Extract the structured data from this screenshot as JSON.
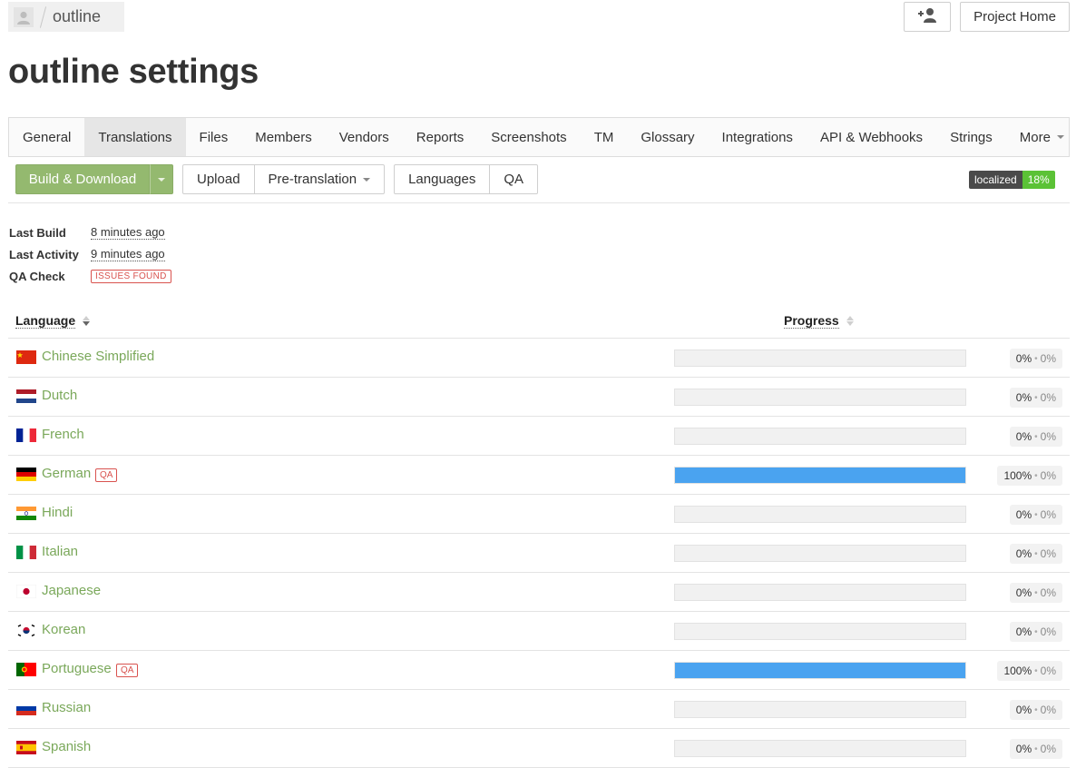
{
  "header": {
    "project_name": "outline",
    "project_home_label": "Project Home",
    "invite_icon": "user-plus-icon",
    "avatar_icon": "user-avatar-icon"
  },
  "page_title": "outline settings",
  "tabs": [
    {
      "label": "General",
      "active": false
    },
    {
      "label": "Translations",
      "active": true
    },
    {
      "label": "Files",
      "active": false
    },
    {
      "label": "Members",
      "active": false
    },
    {
      "label": "Vendors",
      "active": false
    },
    {
      "label": "Reports",
      "active": false
    },
    {
      "label": "Screenshots",
      "active": false
    },
    {
      "label": "TM",
      "active": false
    },
    {
      "label": "Glossary",
      "active": false
    },
    {
      "label": "Integrations",
      "active": false
    },
    {
      "label": "API & Webhooks",
      "active": false
    },
    {
      "label": "Strings",
      "active": false
    },
    {
      "label": "More",
      "active": false,
      "dropdown": true
    }
  ],
  "toolbar": {
    "build_label": "Build & Download",
    "upload_label": "Upload",
    "pretranslation_label": "Pre-translation",
    "languages_label": "Languages",
    "qa_label": "QA"
  },
  "status": {
    "label": "localized",
    "percent": "18%"
  },
  "info": {
    "last_build_label": "Last Build",
    "last_build_value": "8 minutes ago",
    "last_activity_label": "Last Activity",
    "last_activity_value": "9 minutes ago",
    "qa_check_label": "QA Check",
    "qa_check_value": "ISSUES FOUND"
  },
  "table": {
    "col_language": "Language",
    "col_progress": "Progress",
    "rows": [
      {
        "language": "Chinese Simplified",
        "flag": "cn",
        "qa": "",
        "progress": 0,
        "translated": "0%",
        "approved": "0%"
      },
      {
        "language": "Dutch",
        "flag": "nl",
        "qa": "",
        "progress": 0,
        "translated": "0%",
        "approved": "0%"
      },
      {
        "language": "French",
        "flag": "fr",
        "qa": "",
        "progress": 0,
        "translated": "0%",
        "approved": "0%"
      },
      {
        "language": "German",
        "flag": "de",
        "qa": "QA",
        "progress": 100,
        "translated": "100%",
        "approved": "0%"
      },
      {
        "language": "Hindi",
        "flag": "in",
        "qa": "",
        "progress": 0,
        "translated": "0%",
        "approved": "0%"
      },
      {
        "language": "Italian",
        "flag": "it",
        "qa": "",
        "progress": 0,
        "translated": "0%",
        "approved": "0%"
      },
      {
        "language": "Japanese",
        "flag": "jp",
        "qa": "",
        "progress": 0,
        "translated": "0%",
        "approved": "0%"
      },
      {
        "language": "Korean",
        "flag": "kr",
        "qa": "",
        "progress": 0,
        "translated": "0%",
        "approved": "0%"
      },
      {
        "language": "Portuguese",
        "flag": "pt",
        "qa": "QA",
        "progress": 100,
        "translated": "100%",
        "approved": "0%"
      },
      {
        "language": "Russian",
        "flag": "ru",
        "qa": "",
        "progress": 0,
        "translated": "0%",
        "approved": "0%"
      },
      {
        "language": "Spanish",
        "flag": "es",
        "qa": "",
        "progress": 0,
        "translated": "0%",
        "approved": "0%"
      }
    ]
  },
  "colors": {
    "accent_green": "#94b96f",
    "language_link": "#7aa85a",
    "progress_fill": "#4aa3f0",
    "qa_red": "#d9534f",
    "localized_green": "#5bc236"
  }
}
